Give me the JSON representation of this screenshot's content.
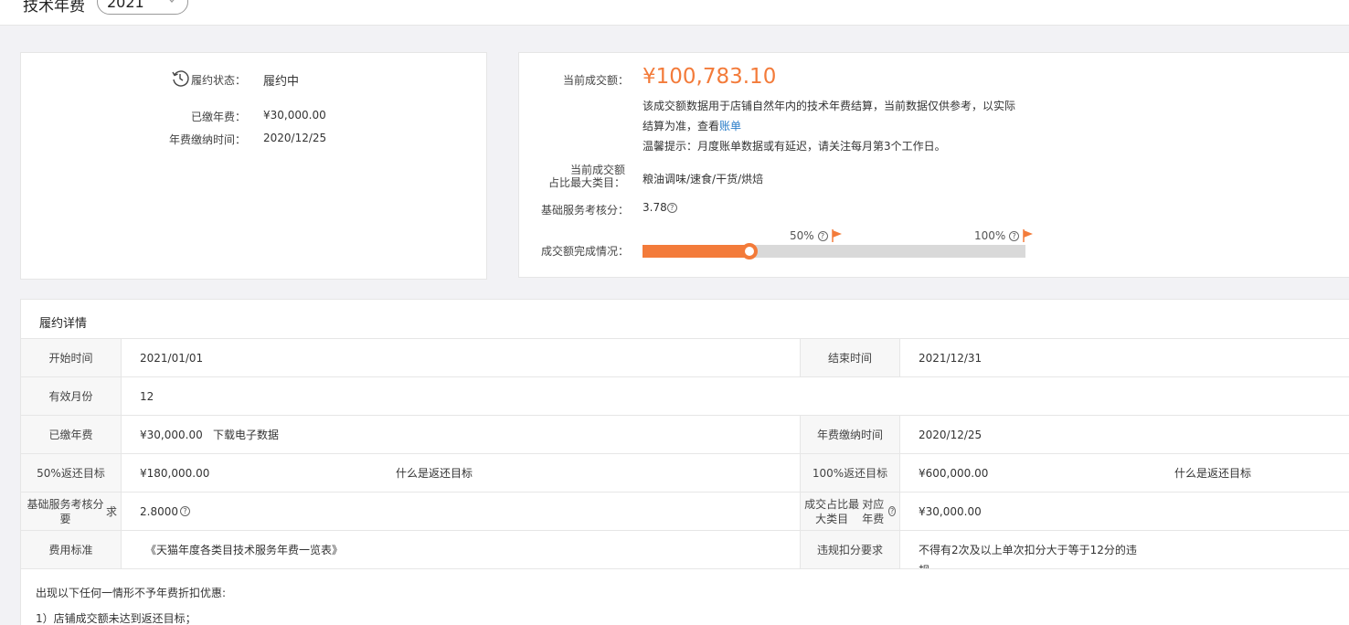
{
  "header": {
    "title": "技术年费",
    "year": "2021"
  },
  "left_card": {
    "status_label": "履约状态：",
    "status_value": "履约中",
    "paid_label": "已缴年费：",
    "paid_value": "¥30,000.00",
    "pay_time_label": "年费缴纳时间：",
    "pay_time_value": "2020/12/25"
  },
  "right_card": {
    "amount_label": "当前成交额：",
    "amount_value": "¥100,783.10",
    "desc_line1": "该成交额数据用于店铺自然年内的技术年费结算，当前数据仅供参考，以实际",
    "desc_line2_prefix": "结算为准，查看",
    "desc_line2_link": "账单",
    "desc_line3": "温馨提示：月度账单数据或有延迟，请关注每月第3个工作日。",
    "category_label_line1": "当前成交额",
    "category_label_line2": "占比最大类目：",
    "category_value": "粮油调味/速食/干货/烘焙",
    "score_label": "基础服务考核分：",
    "score_value": "3.78",
    "progress_label": "成交额完成情况：",
    "marker_50": "50%",
    "marker_100": "100%",
    "progress_fraction": 0.28,
    "accent_color": "#f37b3a"
  },
  "detail": {
    "title": "履约详情",
    "start_label": "开始时间",
    "start_value": "2021/01/01",
    "end_label": "结束时间",
    "end_value": "2021/12/31",
    "months_label": "有效月份",
    "months_value": "12",
    "paid_label": "已缴年费",
    "paid_value": "¥30,000.00",
    "download_link": "下载电子数据",
    "pay_time_label": "年费缴纳时间",
    "pay_time_value": "2020/12/25",
    "target50_label": "50%返还目标",
    "target50_value": "¥180,000.00",
    "target_link": "什么是返还目标",
    "target100_label": "100%返还目标",
    "target100_value": "¥600,000.00",
    "score_req_label_line1": "基础服务考核分要",
    "score_req_label_line2": "求",
    "score_req_value": "2.8000",
    "cat_fee_label_line1": "成交占比最大类目",
    "cat_fee_label_line2": "对应年费",
    "cat_fee_value": "¥30,000.00",
    "fee_std_label": "费用标准",
    "fee_std_link": "《天猫年度各类目技术服务年费一览表》",
    "violation_label": "违规扣分要求",
    "violation_value_line1": "不得有2次及以上单次扣分大于等于12分的违",
    "violation_value_line2": "规",
    "note_line1": "出现以下任何一情形不予年费折扣优惠:",
    "note_line2": "1）店铺成交额未达到返还目标；"
  }
}
